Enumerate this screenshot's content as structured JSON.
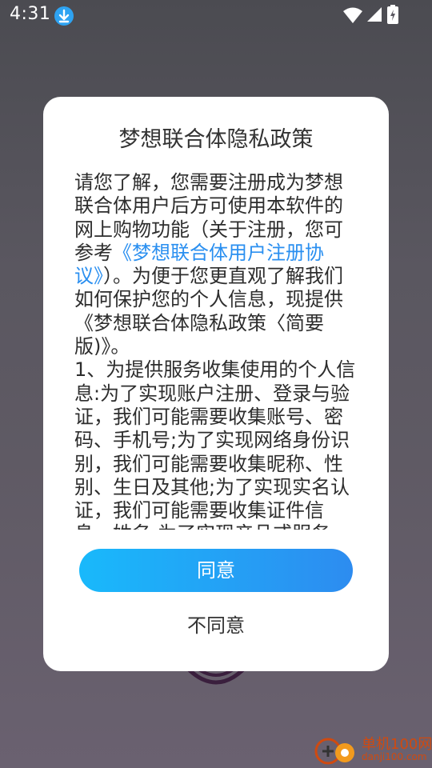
{
  "status_bar": {
    "time": "4:31",
    "download_icon": "download-arrow-icon",
    "wifi_icon": "wifi-icon",
    "signal_icon": "cellular-signal-icon",
    "battery_icon": "battery-charging-icon"
  },
  "dialog": {
    "title": "梦想联合体隐私政策",
    "body_prefix": "请您了解，您需要注册成为梦想联合体用户后方可使用本软件的网上购物功能（关于注册，您可参考",
    "body_link": "《梦想联合体用户注册协议》",
    "body_suffix": "）。为便于您更直观了解我们如何保护您的个人信息，现提供《梦想联合体隐私政策〈简要版)》。",
    "body_section": "1、为提供服务收集使用的个人信息:为了实现账户注册、登录与验证，我们可能需要收集账号、密码、手机号;为了实现网络身份识别，我们可能需要收集昵称、性别、生日及其他;为了实现实名认证，我们可能需要收集证件信息、姓名;为了实现产品或服务",
    "agree_label": "同意",
    "disagree_label": "不同意"
  },
  "watermark": {
    "name": "单机100网",
    "url": "danji100.com"
  },
  "colors": {
    "accent_start": "#19b9fb",
    "accent_end": "#2d8cf0",
    "link": "#2a8ff0",
    "watermark": "#d04a10"
  }
}
